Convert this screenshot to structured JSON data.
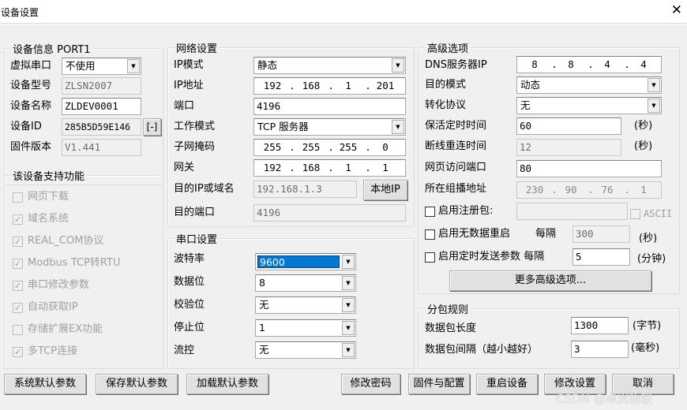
{
  "window": {
    "title": "设备设置"
  },
  "device": {
    "group_title": "设备信息",
    "port_name": "PORT1",
    "virtual_port_label": "虚拟串口",
    "virtual_port_value": "不使用",
    "model_label": "设备型号",
    "model_value": "ZLSN2007",
    "name_label": "设备名称",
    "name_value": "ZLDEV0001",
    "id_label": "设备ID",
    "id_value": "285B5D59E146",
    "id_button": "[-]",
    "fw_label": "固件版本",
    "fw_value": "V1.441"
  },
  "features": {
    "group_title": "该设备支持功能",
    "items": [
      {
        "label": "网页下载",
        "checked": false
      },
      {
        "label": "域名系统",
        "checked": true
      },
      {
        "label": "REAL_COM协议",
        "checked": true
      },
      {
        "label": "Modbus TCP转RTU",
        "checked": true
      },
      {
        "label": "串口修改参数",
        "checked": true
      },
      {
        "label": "自动获取IP",
        "checked": true
      },
      {
        "label": "存储扩展EX功能",
        "checked": false
      },
      {
        "label": "多TCP连接",
        "checked": true
      }
    ]
  },
  "network": {
    "group_title": "网络设置",
    "ip_mode_label": "IP模式",
    "ip_mode_value": "静态",
    "ip_label": "IP地址",
    "ip": [
      "192",
      "168",
      "1",
      "201"
    ],
    "port_label": "端口",
    "port_value": "4196",
    "work_mode_label": "工作模式",
    "work_mode_value": "TCP 服务器",
    "mask_label": "子网掩码",
    "mask": [
      "255",
      "255",
      "255",
      "0"
    ],
    "gateway_label": "网关",
    "gateway": [
      "192",
      "168",
      "1",
      "1"
    ],
    "dest_ip_label": "目的IP或域名",
    "dest_ip_value": "192.168.1.3",
    "local_ip_button": "本地IP",
    "dest_port_label": "目的端口",
    "dest_port_value": "4196"
  },
  "serial": {
    "group_title": "串口设置",
    "baud_label": "波特率",
    "baud_value": "9600",
    "databits_label": "数据位",
    "databits_value": "8",
    "parity_label": "校验位",
    "parity_value": "无",
    "stopbits_label": "停止位",
    "stopbits_value": "1",
    "flow_label": "流控",
    "flow_value": "无"
  },
  "advanced": {
    "group_title": "高级选项",
    "dns_label": "DNS服务器IP",
    "dns": [
      "8",
      "8",
      "4",
      "4"
    ],
    "dest_mode_label": "目的模式",
    "dest_mode_value": "动态",
    "protocol_label": "转化协议",
    "protocol_value": "无",
    "keepalive_label": "保活定时时间",
    "keepalive_value": "60",
    "keepalive_unit": "(秒)",
    "reconnect_label": "断线重连时间",
    "reconnect_value": "12",
    "reconnect_unit": "(秒)",
    "web_port_label": "网页访问端口",
    "web_port_value": "80",
    "multicast_label": "所在组播地址",
    "multicast": [
      "230",
      "90",
      "76",
      "1"
    ],
    "register_label": "启用注册包:",
    "register_value": "",
    "ascii_label": "ASCII",
    "no_data_restart_label": "启用无数据重启",
    "every_label": "每隔",
    "no_data_value": "300",
    "no_data_unit": "(秒)",
    "timed_send_label": "启用定时发送参数 每隔",
    "timed_send_value": "5",
    "timed_send_unit": "(分钟)",
    "more_button": "更多高级选项..."
  },
  "packet": {
    "group_title": "分包规则",
    "length_label": "数据包长度",
    "length_value": "1300",
    "length_unit": "(字节)",
    "interval_label": "数据包间隔（越小越好）",
    "interval_value": "3",
    "interval_unit": "(毫秒)"
  },
  "buttons": {
    "system_default": "系统默认参数",
    "save_default": "保存默认参数",
    "load_default": "加载默认参数",
    "change_password": "修改密码",
    "firmware_config": "固件与配置",
    "restart": "重启设备",
    "modify": "修改设置",
    "cancel": "取消"
  },
  "watermark": "CSDN @卓岚物联"
}
